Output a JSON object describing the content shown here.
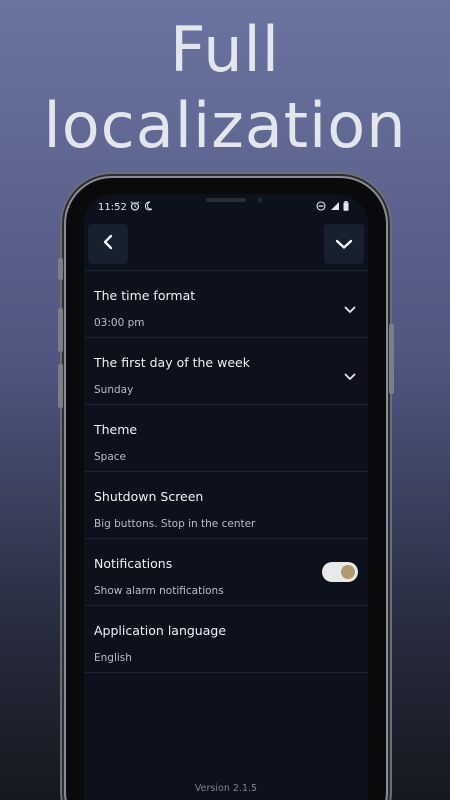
{
  "promo": {
    "line1": "Full",
    "line2": "localization"
  },
  "status_bar": {
    "time": "11:52",
    "icons": [
      "alarm-icon",
      "moon-icon",
      "dnd-icon",
      "signal-icon",
      "battery-icon"
    ]
  },
  "toolbar": {
    "back_icon": "chevron-left-icon",
    "collapse_icon": "chevron-down-icon"
  },
  "settings": {
    "time_format": {
      "title": "The time format",
      "value": "03:00 pm"
    },
    "first_day": {
      "title": "The first day of the week",
      "value": "Sunday"
    },
    "theme": {
      "title": "Theme",
      "value": "Space"
    },
    "shutdown": {
      "title": "Shutdown Screen",
      "value": "Big buttons. Stop in the center"
    },
    "notifications": {
      "title": "Notifications",
      "value": "Show alarm notifications",
      "enabled": true
    },
    "language": {
      "title": "Application language",
      "value": "English"
    }
  },
  "footer": {
    "version": "Version 2.1.5"
  },
  "colors": {
    "background_top": "#6b74a0",
    "screen_bg": "#0c111b",
    "toggle_track": "#e9e9ec",
    "toggle_knob": "#b09a6e"
  }
}
